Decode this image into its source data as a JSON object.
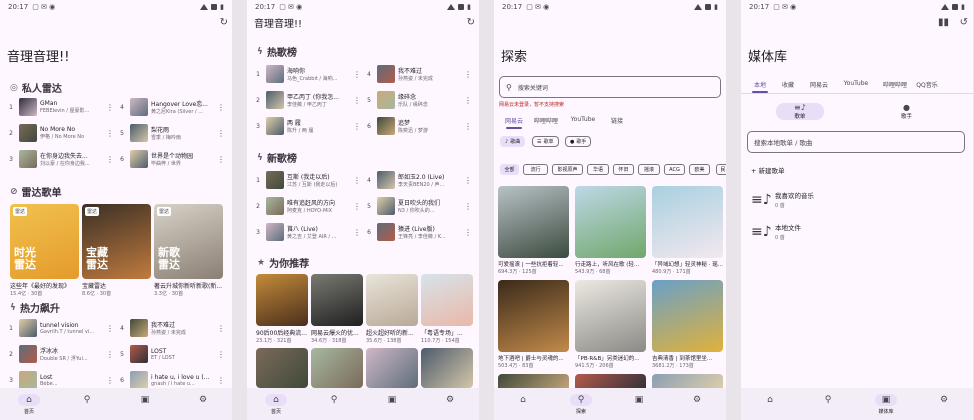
{
  "status": {
    "time": "20:17"
  },
  "screen1": {
    "title": "音理音理!!",
    "sec_radar": "私人雷达",
    "radar_left": [
      {
        "n": "1",
        "t": "GMan",
        "a": "FEBEIevin / 屋豪影..."
      },
      {
        "n": "2",
        "t": "No More No",
        "a": "伊格 / No More No"
      },
      {
        "n": "3",
        "t": "在你身边我失去...",
        "a": "刘以豪 / 在你身边我..."
      }
    ],
    "radar_right": [
      {
        "n": "4",
        "t": "Hangover Love恋...",
        "a": "黄之尼Kira (Silver / ..."
      },
      {
        "n": "5",
        "t": "梨花雨",
        "a": "雪季 / 梅吟雨"
      },
      {
        "n": "6",
        "t": "世界是个动物园",
        "a": "毕曲梓 / 世界"
      }
    ],
    "sec_playlist": "雷达歌单",
    "cards": [
      {
        "tag": "雷达",
        "big": "时光\n雷达",
        "t": "这些年《最好的发现》",
        "s": "15.4亿 · 30首"
      },
      {
        "tag": "雷达",
        "big": "宝藏\n雷达",
        "t": "宝藏雷达",
        "s": "8.6亿 · 30首"
      },
      {
        "tag": "雷达",
        "big": "新歌\n雷达",
        "t": "著云升城你新听新歌(新...",
        "s": "3.3亿 · 30首"
      }
    ],
    "sec_rising": "热力飙升",
    "rising_left": [
      {
        "n": "1",
        "t": "tunnel vision",
        "a": "Gavrilh.T / tunnel vi..."
      },
      {
        "n": "2",
        "t": "浮冰冰",
        "a": "Double SR / 浮Yul..."
      },
      {
        "n": "3",
        "t": "Lost",
        "a": "Bebe..."
      }
    ],
    "rising_right": [
      {
        "n": "4",
        "t": "我不难过",
        "a": "孙燕姿 / 未完成"
      },
      {
        "n": "5",
        "t": "LOST",
        "a": "ET / LOST"
      },
      {
        "n": "6",
        "t": "i hate u, i love u (...",
        "a": "gnash / i hate u..."
      }
    ]
  },
  "screen2": {
    "title": "音理音理!!",
    "sec_hot": "热歌榜",
    "hot_left": [
      {
        "n": "1",
        "t": "海响你",
        "a": "马色_Crabbit / 海响..."
      },
      {
        "n": "2",
        "t": "甲乙丙丁 (你我怎...",
        "a": "李佳薇 / 甲乙丙丁"
      },
      {
        "n": "3",
        "t": "两 履",
        "a": "陈升 / 两 履"
      }
    ],
    "hot_right": [
      {
        "n": "4",
        "t": "我不难过",
        "a": "孙燕姿 / 未完成"
      },
      {
        "n": "5",
        "t": "缘碎念",
        "a": "乐队 / 缘碎念"
      },
      {
        "n": "6",
        "t": "追梦",
        "a": "陈奕迅 / 梦游"
      }
    ],
    "sec_new": "新歌榜",
    "new_left": [
      {
        "n": "1",
        "t": "互斯 (我走以后)",
        "a": "江苏 / 互斯 (我走以后)"
      },
      {
        "n": "2",
        "t": "唯有追赶风的方向",
        "a": "阿麦克 / HOYO-MiX"
      },
      {
        "n": "3",
        "t": "莨八 (Live)",
        "a": "黄之吉 / 艾登 AIR / ..."
      }
    ],
    "new_right": [
      {
        "n": "4",
        "t": "郎如玉2.0 (Live)",
        "a": "李天责BEN20 / 声..."
      },
      {
        "n": "5",
        "t": "夏日吹头的我们",
        "a": "N3 / 你吹头的..."
      },
      {
        "n": "6",
        "t": "猿进 (Live版)",
        "a": "王锋亮 / 李佳薇 / K..."
      }
    ],
    "sec_rec": "为你推荐",
    "rec": [
      {
        "t": "90后00后经典流...",
        "s": "23.1万 · 321首"
      },
      {
        "t": "网易云爆火的优...",
        "s": "34.6万 · 318首"
      },
      {
        "t": "超火超好听的新...",
        "s": "35.6万 · 138首"
      },
      {
        "t": "「粤语专场」...",
        "s": "110.7万 · 154首"
      }
    ]
  },
  "screen3": {
    "title": "探索",
    "search_placeholder": "搜索关键词",
    "warning": "网易云未登录，暂不支持搜索",
    "tabs": [
      "网易云",
      "哔哩哔哩",
      "YouTube",
      "链接"
    ],
    "chips": [
      {
        "ic": "♪",
        "t": "歌曲"
      },
      {
        "ic": "☰",
        "t": "歌单"
      },
      {
        "ic": "●",
        "t": "歌手"
      }
    ],
    "genres": [
      "全部",
      "流行",
      "影视原声",
      "华语",
      "怀旧",
      "摇滚",
      "ACG",
      "欧美",
      "民"
    ],
    "cards": [
      {
        "t": "可爱摇滚 | 一些抗拒着轻...",
        "s": "694.3万 · 125首"
      },
      {
        "t": "行走路上，听风在歌 (轻...",
        "s": "543.9万 · 68首"
      },
      {
        "t": "「异域幻想」轻灵神秘 · 瑶...",
        "s": "480.9万 · 171首"
      },
      {
        "t": "地下酒吧 | 爵士与灵魂的...",
        "s": "503.4万 · 83首"
      },
      {
        "t": "「PB·R&B」另类迷幻的...",
        "s": "941.5万 · 206首"
      },
      {
        "t": "吉典清香 | 到茶馆里坐...",
        "s": "3681.2万 · 173首"
      }
    ]
  },
  "screen4": {
    "title": "媒体库",
    "tabs": [
      "本地",
      "收藏",
      "网易云",
      "YouTube",
      "哔哩哔哩",
      "QQ音乐"
    ],
    "btns": [
      {
        "ic": "≡♪",
        "t": "歌单"
      },
      {
        "ic": "●",
        "t": "歌手"
      }
    ],
    "search_placeholder": "搜索本地歌单 / 歌曲",
    "add": "+ 新建歌单",
    "lists": [
      {
        "t": "我喜欢的音乐",
        "s": "0 首"
      },
      {
        "t": "本地文件",
        "s": "0 首"
      }
    ]
  },
  "nav": {
    "home": "首页",
    "explore": "探索",
    "library": "媒体库"
  }
}
